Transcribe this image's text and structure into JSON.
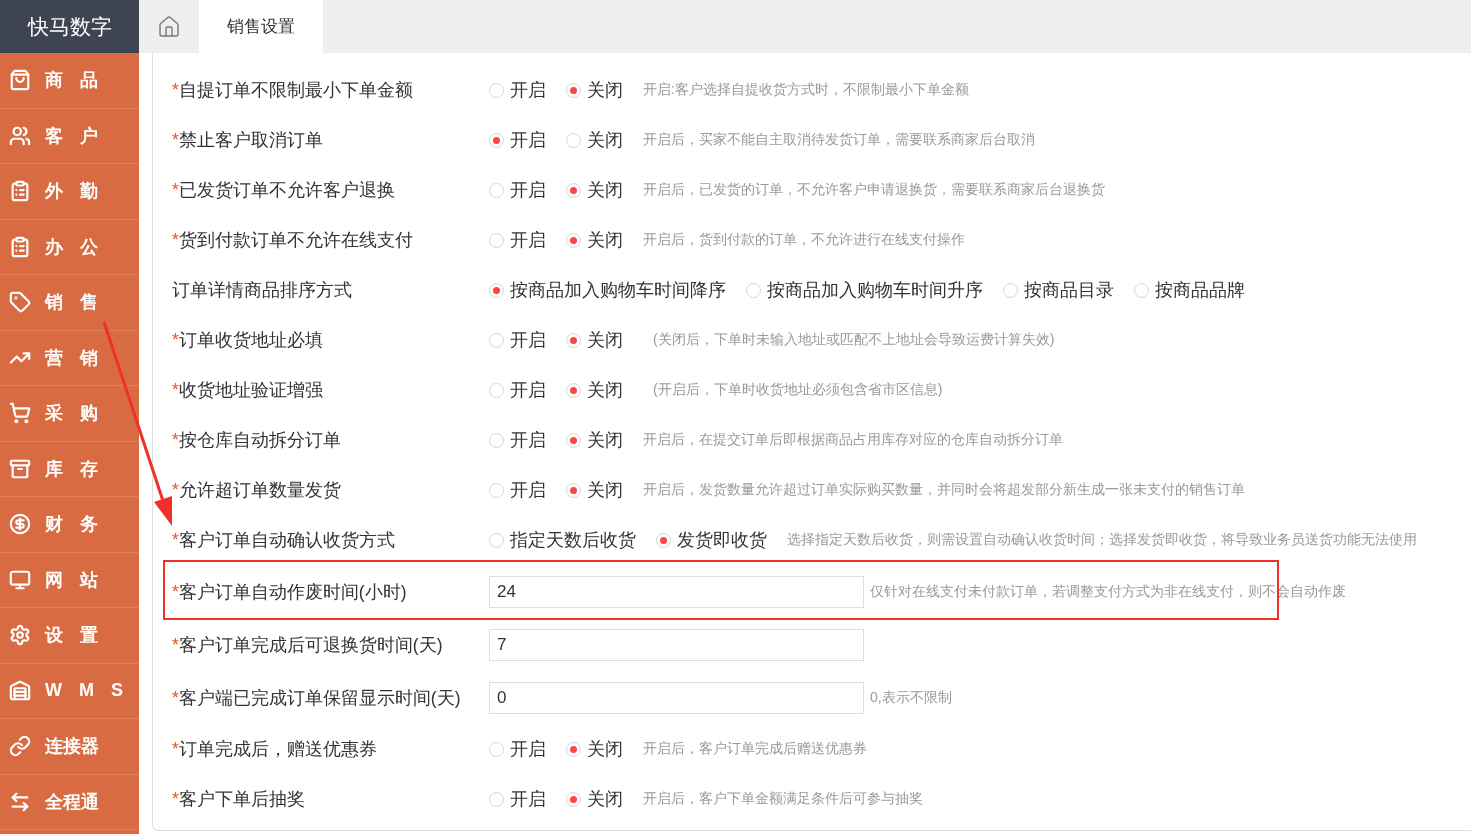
{
  "brand": "快马数字",
  "tabs": [
    {
      "kind": "home",
      "selected": false
    },
    {
      "kind": "text",
      "label": "销售设置",
      "selected": true
    }
  ],
  "sidebar": {
    "items": [
      {
        "label": "商 品"
      },
      {
        "label": "客 户"
      },
      {
        "label": "外 勤"
      },
      {
        "label": "办 公"
      },
      {
        "label": "销 售"
      },
      {
        "label": "营 销"
      },
      {
        "label": "采 购"
      },
      {
        "label": "库 存"
      },
      {
        "label": "财 务"
      },
      {
        "label": "网 站"
      },
      {
        "label": "设 置"
      },
      {
        "label": "W M S"
      },
      {
        "label": "连接器"
      },
      {
        "label": "全程通"
      }
    ]
  },
  "settings": [
    {
      "kind": "radio",
      "mark": "*",
      "label": "自提订单不限制最小下单金额",
      "options": [
        {
          "label": "开启",
          "selected": false
        },
        {
          "label": "关闭",
          "selected": true
        }
      ],
      "hint": "开启:客户选择自提收货方式时，不限制最小下单金额"
    },
    {
      "kind": "radio",
      "mark": "*",
      "label": "禁止客户取消订单",
      "options": [
        {
          "label": "开启",
          "selected": true
        },
        {
          "label": "关闭",
          "selected": false
        }
      ],
      "hint": "开启后，买家不能自主取消待发货订单，需要联系商家后台取消"
    },
    {
      "kind": "radio",
      "mark": "*",
      "label": "已发货订单不允许客户退换",
      "options": [
        {
          "label": "开启",
          "selected": false
        },
        {
          "label": "关闭",
          "selected": true
        }
      ],
      "hint": "开启后，已发货的订单，不允许客户申请退换货，需要联系商家后台退换货"
    },
    {
      "kind": "radio",
      "mark": "*",
      "label": "货到付款订单不允许在线支付",
      "options": [
        {
          "label": "开启",
          "selected": false
        },
        {
          "label": "关闭",
          "selected": true
        }
      ],
      "hint": "开启后，货到付款的订单，不允许进行在线支付操作"
    },
    {
      "kind": "radio",
      "label": "订单详情商品排序方式",
      "options": [
        {
          "label": "按商品加入购物车时间降序",
          "selected": true
        },
        {
          "label": "按商品加入购物车时间升序",
          "selected": false
        },
        {
          "label": "按商品目录",
          "selected": false
        },
        {
          "label": "按商品品牌",
          "selected": false
        }
      ]
    },
    {
      "kind": "radio",
      "mark": "*",
      "label": "订单收货地址必填",
      "options": [
        {
          "label": "开启",
          "selected": false
        },
        {
          "label": "关闭",
          "selected": true
        }
      ],
      "hint": "(关闭后，下单时未输入地址或匹配不上地址会导致运费计算失效)"
    },
    {
      "kind": "radio",
      "mark": "*",
      "label": "收货地址验证增强",
      "options": [
        {
          "label": "开启",
          "selected": false
        },
        {
          "label": "关闭",
          "selected": true
        }
      ],
      "hint": "(开启后，下单时收货地址必须包含省市区信息)"
    },
    {
      "kind": "radio",
      "mark": "*",
      "label": "按仓库自动拆分订单",
      "options": [
        {
          "label": "开启",
          "selected": false
        },
        {
          "label": "关闭",
          "selected": true
        }
      ],
      "hint": "开启后，在提交订单后即根据商品占用库存对应的仓库自动拆分订单"
    },
    {
      "kind": "radio",
      "mark": "*",
      "label": "允许超订单数量发货",
      "options": [
        {
          "label": "开启",
          "selected": false
        },
        {
          "label": "关闭",
          "selected": true
        }
      ],
      "hint": "开启后，发货数量允许超过订单实际购买数量，并同时会将超发部分新生成一张未支付的销售订单"
    },
    {
      "kind": "radio",
      "mark": "*",
      "label": "客户订单自动确认收货方式",
      "options": [
        {
          "label": "指定天数后收货",
          "selected": false
        },
        {
          "label": "发货即收货",
          "selected": true
        }
      ],
      "hint": "选择指定天数后收货，则需设置自动确认收货时间；选择发货即收货，将导致业务员送货功能无法使用"
    },
    {
      "kind": "input",
      "mark": "*",
      "highlighted": true,
      "label": "客户订单自动作废时间(小时)",
      "value": "24",
      "hint": "仅针对在线支付未付款订单，若调整支付方式为非在线支付，则不会自动作废"
    },
    {
      "kind": "input",
      "mark": "*",
      "label": "客户订单完成后可退换货时间(天)",
      "value": "7"
    },
    {
      "kind": "input",
      "mark": "*",
      "label": "客户端已完成订单保留显示时间(天)",
      "value": "0",
      "hint": "0,表示不限制"
    },
    {
      "kind": "radio",
      "mark": "*",
      "label": "订单完成后，赠送优惠券",
      "options": [
        {
          "label": "开启",
          "selected": false
        },
        {
          "label": "关闭",
          "selected": true
        }
      ],
      "hint": "开启后，客户订单完成后赠送优惠券"
    },
    {
      "kind": "radio",
      "mark": "*",
      "label": "客户下单后抽奖",
      "options": [
        {
          "label": "开启",
          "selected": false
        },
        {
          "label": "关闭",
          "selected": true
        }
      ],
      "hint": "开启后，客户下单金额满足条件后可参与抽奖"
    }
  ]
}
